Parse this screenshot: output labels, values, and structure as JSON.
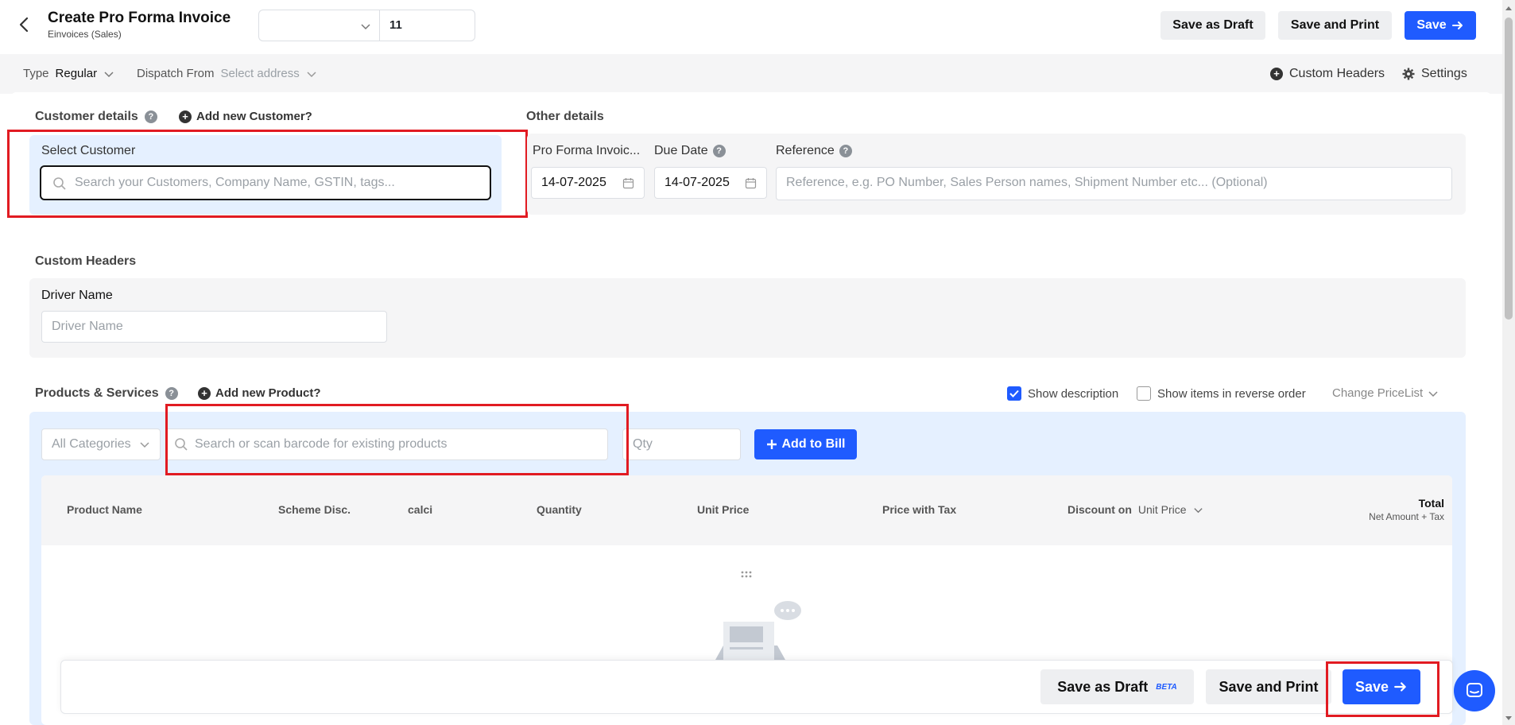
{
  "header": {
    "title": "Create Pro Forma Invoice",
    "subtitle": "Einvoices (Sales)",
    "series_value": "",
    "invoice_number": "11",
    "save_draft_label": "Save as Draft",
    "save_print_label": "Save and Print",
    "save_label": "Save"
  },
  "subbar": {
    "type_label": "Type",
    "type_value": "Regular",
    "dispatch_label": "Dispatch From",
    "dispatch_value": "Select address",
    "custom_headers_label": "Custom Headers",
    "settings_label": "Settings"
  },
  "customer": {
    "heading": "Customer details",
    "add_link": "Add new Customer?",
    "select_label": "Select Customer",
    "search_placeholder": "Search your Customers, Company Name, GSTIN, tags..."
  },
  "other": {
    "heading": "Other details",
    "proforma_label": "Pro Forma Invoic...",
    "proforma_date": "14-07-2025",
    "due_label": "Due Date",
    "due_date": "14-07-2025",
    "reference_label": "Reference",
    "reference_placeholder": "Reference, e.g. PO Number, Sales Person names, Shipment Number etc... (Optional)"
  },
  "custom_headers": {
    "heading": "Custom Headers",
    "driver_label": "Driver Name",
    "driver_placeholder": "Driver Name"
  },
  "products": {
    "heading": "Products & Services",
    "add_link": "Add new Product?",
    "show_description": "Show description",
    "show_description_checked": true,
    "reverse_order": "Show items in reverse order",
    "reverse_order_checked": false,
    "change_pricelist": "Change PriceList",
    "category_value": "All Categories",
    "search_placeholder": "Search or scan barcode for existing products",
    "qty_placeholder": "Qty",
    "add_to_bill": "Add to Bill",
    "columns": {
      "product_name": "Product Name",
      "scheme_disc": "Scheme Disc.",
      "calci": "calci",
      "quantity": "Quantity",
      "unit_price": "Unit Price",
      "price_with_tax": "Price with Tax",
      "discount_on": "Discount on",
      "discount_on_value": "Unit Price",
      "total": "Total",
      "total_sub": "Net Amount + Tax"
    }
  },
  "bottombar": {
    "save_draft_label": "Save as Draft",
    "beta_badge": "BETA",
    "save_print_label": "Save and Print",
    "save_label": "Save"
  },
  "colors": {
    "accent": "#1f5bff",
    "highlight_border": "#e11b22",
    "light_blue_panel": "#e5f0ff"
  }
}
